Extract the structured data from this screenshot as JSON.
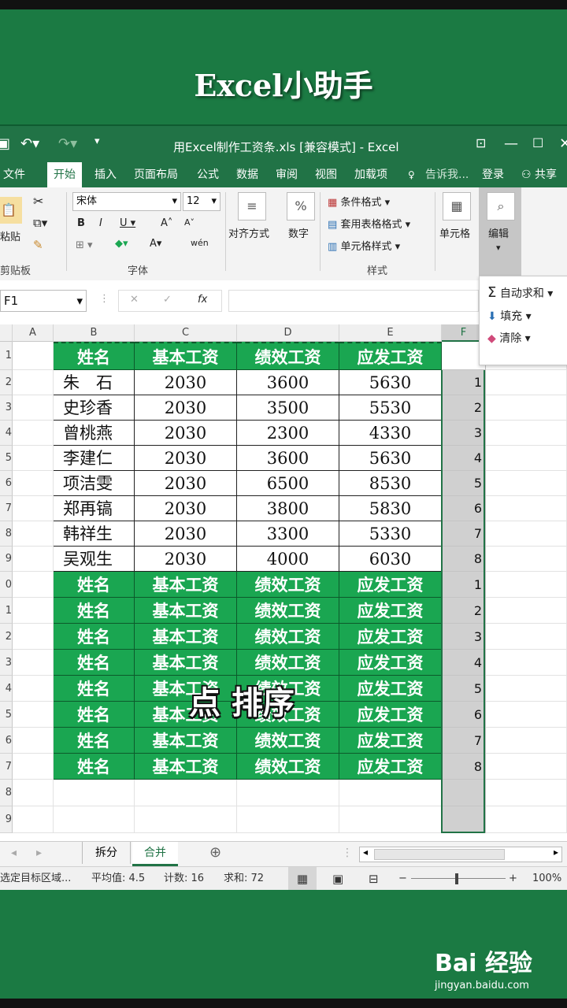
{
  "page_title": "Excel小助手",
  "window": {
    "title": "用Excel制作工资条.xls  [兼容模式] - Excel"
  },
  "tabs": [
    "文件",
    "开始",
    "插入",
    "页面布局",
    "公式",
    "数据",
    "审阅",
    "视图",
    "加载项"
  ],
  "tell_me": "告诉我...",
  "login": "登录",
  "share": "共享",
  "ribbon": {
    "paste": "粘贴",
    "clipboard": "剪贴板",
    "font_name": "宋体",
    "font_size": "12",
    "font_group": "字体",
    "align": "对齐方式",
    "number": "数字",
    "cond_format": "条件格式",
    "table_format": "套用表格格式",
    "cell_style": "单元格样式",
    "style_group": "样式",
    "cells": "单元格",
    "edit": "编辑"
  },
  "edit_menu": [
    "自动求和",
    "填充",
    "清除"
  ],
  "name_box": "F1",
  "columns": [
    "A",
    "B",
    "C",
    "D",
    "E",
    "F"
  ],
  "header_row": [
    "姓名",
    "基本工资",
    "绩效工资",
    "应发工资"
  ],
  "data_rows": [
    {
      "name": "朱　石",
      "base": "2030",
      "perf": "3600",
      "total": "5630",
      "f": "1"
    },
    {
      "name": "史珍香",
      "base": "2030",
      "perf": "3500",
      "total": "5530",
      "f": "2"
    },
    {
      "name": "曾桃燕",
      "base": "2030",
      "perf": "2300",
      "total": "4330",
      "f": "3"
    },
    {
      "name": "李建仁",
      "base": "2030",
      "perf": "3600",
      "total": "5630",
      "f": "4"
    },
    {
      "name": "项洁雯",
      "base": "2030",
      "perf": "6500",
      "total": "8530",
      "f": "5"
    },
    {
      "name": "郑再镐",
      "base": "2030",
      "perf": "3800",
      "total": "5830",
      "f": "6"
    },
    {
      "name": "韩祥生",
      "base": "2030",
      "perf": "3300",
      "total": "5330",
      "f": "7"
    },
    {
      "name": "吴观生",
      "base": "2030",
      "perf": "4000",
      "total": "6030",
      "f": "8"
    }
  ],
  "copied_header_f": [
    "1",
    "2",
    "3",
    "4",
    "5",
    "6",
    "7",
    "8"
  ],
  "row_numbers": [
    "1",
    "2",
    "3",
    "4",
    "5",
    "6",
    "7",
    "8",
    "9",
    "0",
    "1",
    "2",
    "3",
    "4",
    "5",
    "6",
    "7",
    "8",
    "9"
  ],
  "overlay_text": "点 排序",
  "sheet_tabs": [
    "拆分",
    "合并"
  ],
  "status": {
    "mode": "选定目标区域...",
    "avg": "平均值: 4.5",
    "count": "计数: 16",
    "sum": "求和: 72",
    "zoom": "100%"
  },
  "watermark": "Bai 经验",
  "watermark_url": "jingyan.baidu.com"
}
